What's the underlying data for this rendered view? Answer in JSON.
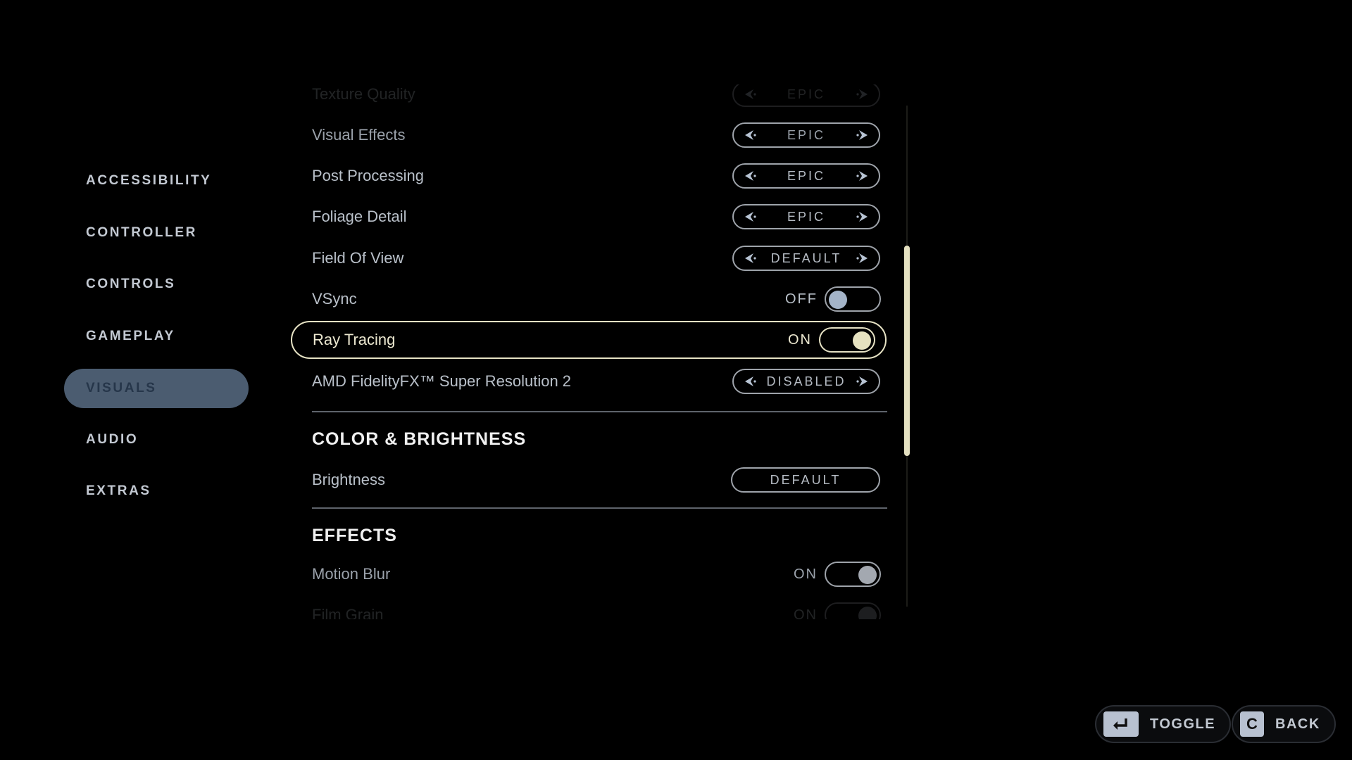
{
  "sidebar": {
    "items": [
      {
        "label": "ACCESSIBILITY",
        "active": false
      },
      {
        "label": "CONTROLLER",
        "active": false
      },
      {
        "label": "CONTROLS",
        "active": false
      },
      {
        "label": "GAMEPLAY",
        "active": false
      },
      {
        "label": "VISUALS",
        "active": true
      },
      {
        "label": "AUDIO",
        "active": false
      },
      {
        "label": "EXTRAS",
        "active": false
      }
    ]
  },
  "settings": {
    "texture_quality": {
      "label": "Texture Quality",
      "value": "EPIC"
    },
    "visual_effects": {
      "label": "Visual Effects",
      "value": "EPIC"
    },
    "post_processing": {
      "label": "Post Processing",
      "value": "EPIC"
    },
    "foliage_detail": {
      "label": "Foliage Detail",
      "value": "EPIC"
    },
    "field_of_view": {
      "label": "Field Of View",
      "value": "DEFAULT"
    },
    "vsync": {
      "label": "VSync",
      "state": "OFF"
    },
    "ray_tracing": {
      "label": "Ray Tracing",
      "state": "ON"
    },
    "fsr2": {
      "label": "AMD FidelityFX™ Super Resolution 2",
      "value": "DISABLED"
    }
  },
  "sections": {
    "color_brightness": {
      "title": "COLOR & BRIGHTNESS",
      "brightness": {
        "label": "Brightness",
        "button": "DEFAULT"
      }
    },
    "effects": {
      "title": "EFFECTS",
      "motion_blur": {
        "label": "Motion Blur",
        "state": "ON"
      },
      "film_grain": {
        "label": "Film Grain",
        "state": "ON"
      }
    }
  },
  "scroll": {
    "position_fraction": 0.28,
    "visible_fraction": 0.42
  },
  "footer": {
    "toggle": {
      "key": "↵",
      "label": "TOGGLE"
    },
    "back": {
      "key": "C",
      "label": "BACK"
    }
  },
  "colors": {
    "accent": "#e6e2c4",
    "nav_active_bg": "#4b5c70",
    "text": "#b9c0c9"
  }
}
